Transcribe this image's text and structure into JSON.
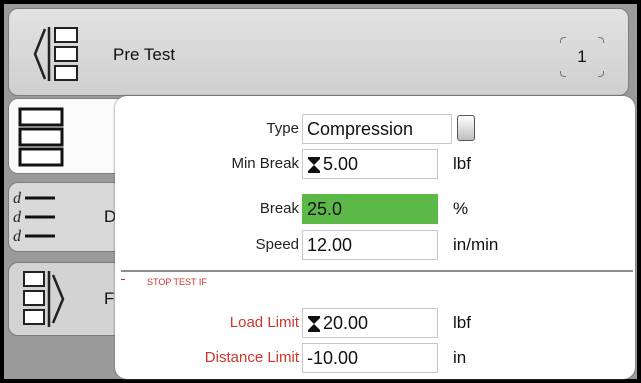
{
  "header": {
    "title": "Pre Test",
    "page_number": "1"
  },
  "background_items": [
    {
      "label": ""
    },
    {
      "label": "D"
    },
    {
      "label": "F"
    }
  ],
  "panel": {
    "type": {
      "label": "Type",
      "value": "Compression"
    },
    "min_break": {
      "label": "Min Break",
      "value": "5.00",
      "unit": "lbf"
    },
    "break": {
      "label": "Break",
      "value": "25.0",
      "unit": "%"
    },
    "speed": {
      "label": "Speed",
      "value": "12.00",
      "unit": "in/min"
    },
    "section_title": "STOP TEST IF",
    "load_limit": {
      "label": "Load Limit",
      "value": "20.00",
      "unit": "lbf"
    },
    "distance_limit": {
      "label": "Distance Limit",
      "value": "-10.00",
      "unit": "in"
    }
  },
  "colors": {
    "highlight": "#5cb947",
    "warning_red": "#d0342c"
  },
  "icons": [
    "back-list-icon",
    "list-icon",
    "data-list-icon",
    "forward-list-icon",
    "spinner-icon"
  ]
}
